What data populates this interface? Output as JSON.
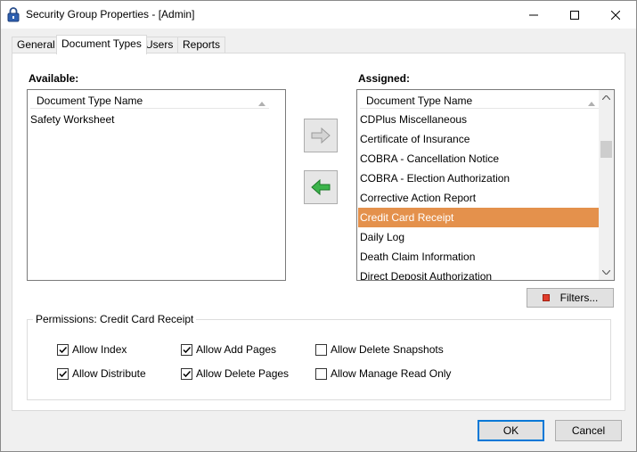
{
  "window": {
    "title": "Security Group Properties - [Admin]"
  },
  "tabs": [
    {
      "label": "General"
    },
    {
      "label": "Document Types"
    },
    {
      "label": "Users"
    },
    {
      "label": "Reports"
    }
  ],
  "available": {
    "label": "Available:",
    "column_header": "Document Type Name",
    "items": [
      "Safety Worksheet"
    ]
  },
  "assigned": {
    "label": "Assigned:",
    "column_header": "Document Type Name",
    "items": [
      "CDPlus Miscellaneous",
      "Certificate of Insurance",
      "COBRA - Cancellation Notice",
      "COBRA - Election Authorization",
      "Corrective Action Report",
      "Credit Card Receipt",
      "Daily Log",
      "Death Claim Information",
      "Direct Deposit Authorization"
    ],
    "selected_index": 5
  },
  "filters_button": "Filters...",
  "permissions": {
    "title": "Permissions: Credit Card Receipt",
    "allow_index": {
      "label": "Allow Index",
      "checked": true
    },
    "allow_distribute": {
      "label": "Allow Distribute",
      "checked": true
    },
    "allow_add_pages": {
      "label": "Allow Add Pages",
      "checked": true
    },
    "allow_delete_pages": {
      "label": "Allow Delete Pages",
      "checked": true
    },
    "allow_delete_snapshots": {
      "label": "Allow Delete Snapshots",
      "checked": false
    },
    "allow_manage_read_only": {
      "label": "Allow Manage Read Only",
      "checked": false
    }
  },
  "footer": {
    "ok": "OK",
    "cancel": "Cancel"
  },
  "colors": {
    "selection": "#e4914c",
    "add_arrow_green": "#3cb44b",
    "dialog_bg": "#f0f0f0"
  },
  "icons": {
    "app": "lock-icon",
    "move_right": "arrow-right-icon",
    "move_left": "arrow-left-icon",
    "filters": "red-square-icon"
  }
}
